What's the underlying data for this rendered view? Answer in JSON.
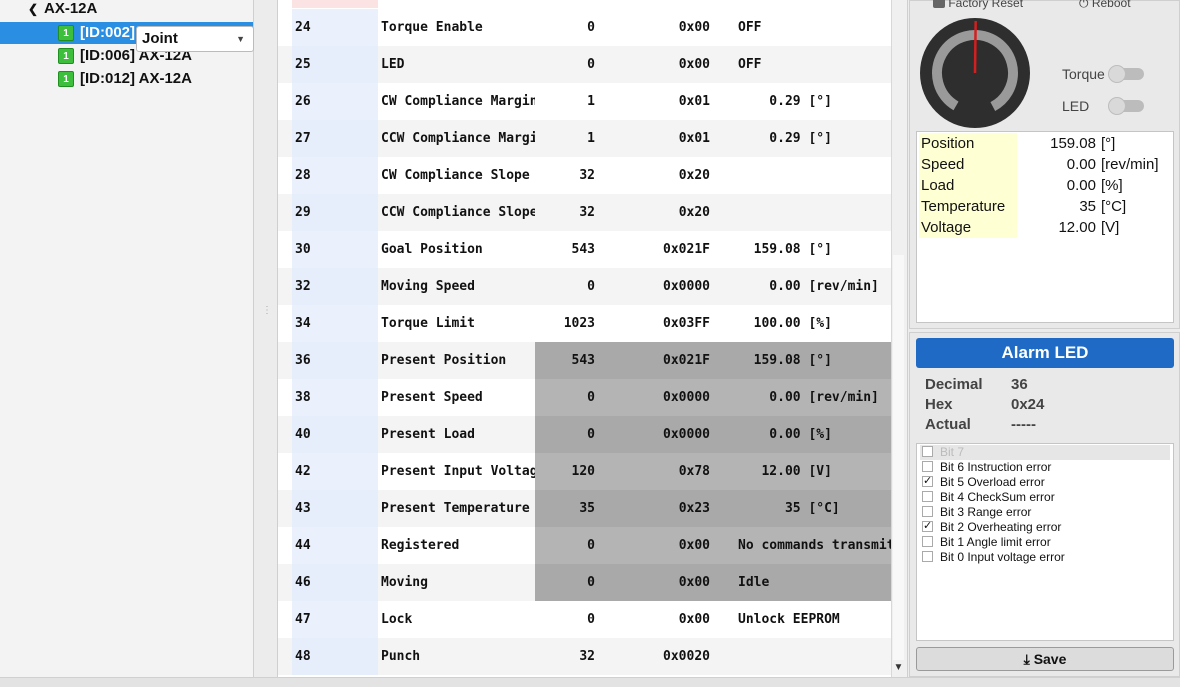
{
  "tree": {
    "group_label": "AX-12A",
    "items": [
      {
        "label": "[ID:002] AX-12A",
        "icon_text": "1"
      },
      {
        "label": "[ID:006] AX-12A",
        "icon_text": "1"
      },
      {
        "label": "[ID:012] AX-12A",
        "icon_text": "1"
      }
    ]
  },
  "table": {
    "rows": [
      {
        "addr": "24",
        "name": "Torque Enable",
        "dec": "0",
        "hex": "0x00",
        "actual": "OFF",
        "ro": false
      },
      {
        "addr": "25",
        "name": "LED",
        "dec": "0",
        "hex": "0x00",
        "actual": "OFF",
        "ro": false
      },
      {
        "addr": "26",
        "name": "CW Compliance Margin",
        "dec": "1",
        "hex": "0x01",
        "actual": "    0.29 [°]",
        "ro": false
      },
      {
        "addr": "27",
        "name": "CCW Compliance Margin",
        "dec": "1",
        "hex": "0x01",
        "actual": "    0.29 [°]",
        "ro": false
      },
      {
        "addr": "28",
        "name": "CW Compliance Slope",
        "dec": "32",
        "hex": "0x20",
        "actual": "",
        "ro": false
      },
      {
        "addr": "29",
        "name": "CCW Compliance Slope",
        "dec": "32",
        "hex": "0x20",
        "actual": "",
        "ro": false
      },
      {
        "addr": "30",
        "name": "Goal Position",
        "dec": "543",
        "hex": "0x021F",
        "actual": "  159.08 [°]",
        "ro": false
      },
      {
        "addr": "32",
        "name": "Moving Speed",
        "dec": "0",
        "hex": "0x0000",
        "actual": "    0.00 [rev/min]",
        "ro": false
      },
      {
        "addr": "34",
        "name": "Torque Limit",
        "dec": "1023",
        "hex": "0x03FF",
        "actual": "  100.00 [%]",
        "ro": false
      },
      {
        "addr": "36",
        "name": "Present Position",
        "dec": "543",
        "hex": "0x021F",
        "actual": "  159.08 [°]",
        "ro": true
      },
      {
        "addr": "38",
        "name": "Present Speed",
        "dec": "0",
        "hex": "0x0000",
        "actual": "    0.00 [rev/min]",
        "ro": true
      },
      {
        "addr": "40",
        "name": "Present Load",
        "dec": "0",
        "hex": "0x0000",
        "actual": "    0.00 [%]",
        "ro": true
      },
      {
        "addr": "42",
        "name": "Present Input Voltage",
        "dec": "120",
        "hex": "0x78",
        "actual": "   12.00 [V]",
        "ro": true
      },
      {
        "addr": "43",
        "name": "Present Temperature",
        "dec": "35",
        "hex": "0x23",
        "actual": "      35 [°C]",
        "ro": true
      },
      {
        "addr": "44",
        "name": "Registered",
        "dec": "0",
        "hex": "0x00",
        "actual": "No commands transmit…",
        "ro": true
      },
      {
        "addr": "46",
        "name": "Moving",
        "dec": "0",
        "hex": "0x00",
        "actual": "Idle",
        "ro": true
      },
      {
        "addr": "47",
        "name": "Lock",
        "dec": "0",
        "hex": "0x00",
        "actual": "Unlock EEPROM",
        "ro": false
      },
      {
        "addr": "48",
        "name": "Punch",
        "dec": "32",
        "hex": "0x0020",
        "actual": "",
        "ro": false
      }
    ]
  },
  "toolbar": {
    "factory_reset_label": "Factory Reset",
    "reboot_label": "Reboot"
  },
  "control": {
    "mode": "Joint",
    "torque_label": "Torque",
    "led_label": "LED",
    "torque_on": false,
    "led_on": false,
    "dial_angle_deg": 159.08
  },
  "status": [
    {
      "key": "Position",
      "value": "159.08",
      "unit": "[°]"
    },
    {
      "key": "Speed",
      "value": "0.00",
      "unit": "[rev/min]"
    },
    {
      "key": "Load",
      "value": "0.00",
      "unit": "[%]"
    },
    {
      "key": "Temperature",
      "value": "35",
      "unit": "[°C]"
    },
    {
      "key": "Voltage",
      "value": "12.00",
      "unit": "[V]"
    }
  ],
  "alarm": {
    "title": "Alarm LED",
    "decimal_label": "Decimal",
    "decimal_value": "36",
    "hex_label": "Hex",
    "hex_value": "0x24",
    "actual_label": "Actual",
    "actual_value": "-----",
    "bits": [
      {
        "label": "Bit 7",
        "checked": false,
        "dim": true
      },
      {
        "label": "Bit 6 Instruction error",
        "checked": false,
        "dim": false
      },
      {
        "label": "Bit 5 Overload error",
        "checked": true,
        "dim": false
      },
      {
        "label": "Bit 4 CheckSum error",
        "checked": false,
        "dim": false
      },
      {
        "label": "Bit 3 Range error",
        "checked": false,
        "dim": false
      },
      {
        "label": "Bit 2 Overheating error",
        "checked": true,
        "dim": false
      },
      {
        "label": "Bit 1 Angle limit error",
        "checked": false,
        "dim": false
      },
      {
        "label": "Bit 0 Input voltage error",
        "checked": false,
        "dim": false
      }
    ],
    "save_label": "Save"
  },
  "colors": {
    "selection": "#2a8ee3",
    "alarm_header": "#1e6ac4",
    "readonly_cell": "#a9a9a9",
    "status_key_bg": "#ffffd4",
    "motor_icon": "#3dbf3d"
  }
}
